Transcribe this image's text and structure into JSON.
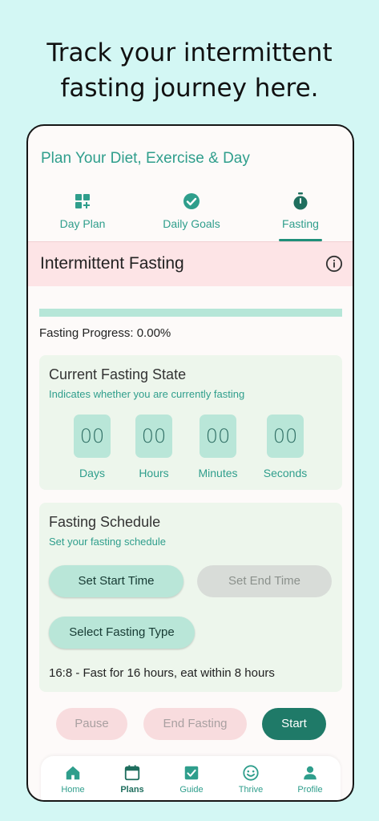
{
  "promo": {
    "line1": "Track your intermittent",
    "line2": "fasting journey here."
  },
  "app": {
    "title": "Plan Your Diet, Exercise & Day"
  },
  "tabs": [
    {
      "label": "Day Plan",
      "icon": "dashboard-add-icon"
    },
    {
      "label": "Daily Goals",
      "icon": "check-circle-icon"
    },
    {
      "label": "Fasting",
      "icon": "stopwatch-icon",
      "active": true
    }
  ],
  "section": {
    "title": "Intermittent Fasting",
    "info_icon": "info-icon"
  },
  "progress": {
    "label": "Fasting Progress: 0.00%",
    "percent": 0
  },
  "state_card": {
    "title": "Current Fasting State",
    "subtitle": "Indicates whether you are currently fasting",
    "timers": [
      {
        "value": "00",
        "label": "Days"
      },
      {
        "value": "00",
        "label": "Hours"
      },
      {
        "value": "00",
        "label": "Minutes"
      },
      {
        "value": "00",
        "label": "Seconds"
      }
    ]
  },
  "schedule_card": {
    "title": "Fasting Schedule",
    "subtitle": "Set your fasting schedule",
    "set_start": "Set Start Time",
    "set_end": "Set End Time",
    "select_type": "Select Fasting Type",
    "description": "16:8 - Fast for 16 hours, eat within 8 hours"
  },
  "actions": {
    "pause": "Pause",
    "end": "End Fasting",
    "start": "Start"
  },
  "bottom_nav": [
    {
      "label": "Home",
      "icon": "home-icon"
    },
    {
      "label": "Plans",
      "icon": "calendar-icon",
      "active": true
    },
    {
      "label": "Guide",
      "icon": "checkbox-icon"
    },
    {
      "label": "Thrive",
      "icon": "smiley-icon"
    },
    {
      "label": "Profile",
      "icon": "person-icon"
    }
  ],
  "colors": {
    "background": "#d3f7f4",
    "accent": "#2f9e8c",
    "primary_dark": "#1f7a68",
    "header_pink": "#fde4e6",
    "card_green": "#edf6ec",
    "chip_green": "#b9e6d8"
  }
}
